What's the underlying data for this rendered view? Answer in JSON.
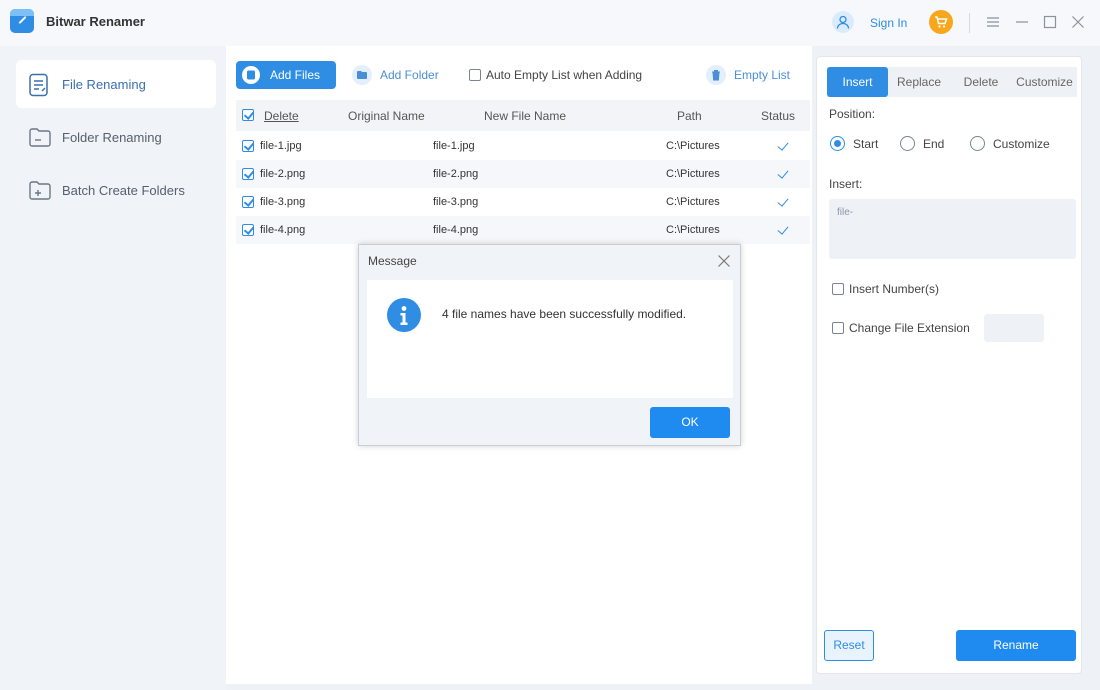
{
  "app": {
    "title": "Bitwar Renamer"
  },
  "titlebar": {
    "sign_in": "Sign In"
  },
  "sidebar": {
    "items": [
      {
        "label": "File Renaming"
      },
      {
        "label": "Folder Renaming"
      },
      {
        "label": "Batch Create Folders"
      }
    ]
  },
  "toolbar": {
    "add_files": "Add Files",
    "add_folder": "Add Folder",
    "auto_empty": "Auto Empty List when Adding",
    "empty_list": "Empty List"
  },
  "table": {
    "headers": {
      "delete": "Delete",
      "original": "Original Name",
      "new": "New File Name",
      "path": "Path",
      "status": "Status"
    },
    "rows": [
      {
        "original": "file-1.jpg",
        "new": "file-1.jpg",
        "path": "C:\\Pictures"
      },
      {
        "original": "file-2.png",
        "new": "file-2.png",
        "path": "C:\\Pictures"
      },
      {
        "original": "file-3.png",
        "new": "file-3.png",
        "path": "C:\\Pictures"
      },
      {
        "original": "file-4.png",
        "new": "file-4.png",
        "path": "C:\\Pictures"
      }
    ]
  },
  "panel": {
    "tabs": [
      "Insert",
      "Replace",
      "Delete",
      "Customize"
    ],
    "position_label": "Position:",
    "position_options": [
      "Start",
      "End",
      "Customize"
    ],
    "insert_label": "Insert:",
    "insert_value": "file-",
    "insert_numbers": "Insert Number(s)",
    "change_extension": "Change File Extension",
    "reset": "Reset",
    "rename": "Rename"
  },
  "dialog": {
    "title": "Message",
    "message": "4 file names have been successfully modified.",
    "ok": "OK"
  },
  "colors": {
    "accent": "#2f8de4",
    "cart": "#f8a61c"
  }
}
